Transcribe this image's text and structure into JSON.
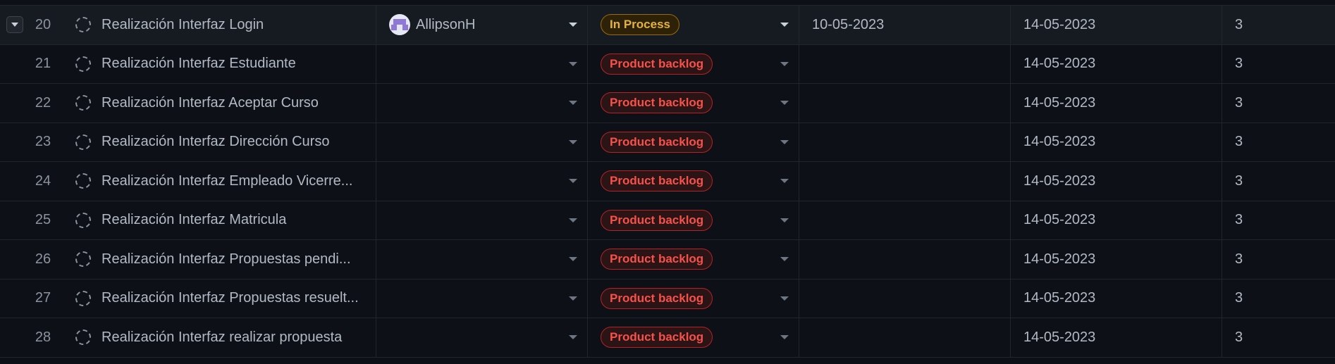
{
  "rows": [
    {
      "num": "20",
      "title": "Realización Interfaz Login",
      "assignee": "AllipsonH",
      "status": "In Process",
      "start": "10-05-2023",
      "end": "14-05-2023",
      "points": "3"
    },
    {
      "num": "21",
      "title": "Realización Interfaz Estudiante",
      "assignee": "",
      "status": "Product backlog",
      "start": "",
      "end": "14-05-2023",
      "points": "3"
    },
    {
      "num": "22",
      "title": "Realización Interfaz Aceptar Curso",
      "assignee": "",
      "status": "Product backlog",
      "start": "",
      "end": "14-05-2023",
      "points": "3"
    },
    {
      "num": "23",
      "title": "Realización Interfaz Dirección Curso",
      "assignee": "",
      "status": "Product backlog",
      "start": "",
      "end": "14-05-2023",
      "points": "3"
    },
    {
      "num": "24",
      "title": "Realización Interfaz Empleado Vicerre...",
      "assignee": "",
      "status": "Product backlog",
      "start": "",
      "end": "14-05-2023",
      "points": "3"
    },
    {
      "num": "25",
      "title": "Realización Interfaz Matricula",
      "assignee": "",
      "status": "Product backlog",
      "start": "",
      "end": "14-05-2023",
      "points": "3"
    },
    {
      "num": "26",
      "title": "Realización Interfaz Propuestas pendi...",
      "assignee": "",
      "status": "Product backlog",
      "start": "",
      "end": "14-05-2023",
      "points": "3"
    },
    {
      "num": "27",
      "title": "Realización Interfaz Propuestas resuelt...",
      "assignee": "",
      "status": "Product backlog",
      "start": "",
      "end": "14-05-2023",
      "points": "3"
    },
    {
      "num": "28",
      "title": "Realización Interfaz realizar propuesta",
      "assignee": "",
      "status": "Product backlog",
      "start": "",
      "end": "14-05-2023",
      "points": "3"
    }
  ],
  "icons": {
    "expand": "chevron-down-icon",
    "item_status": "dashed-circle-icon",
    "dropdown": "caret-down-icon"
  },
  "colors": {
    "background": "#0d1117",
    "selected_row": "#161b22",
    "in_process_text": "#e3b341",
    "backlog_text": "#f85149"
  }
}
